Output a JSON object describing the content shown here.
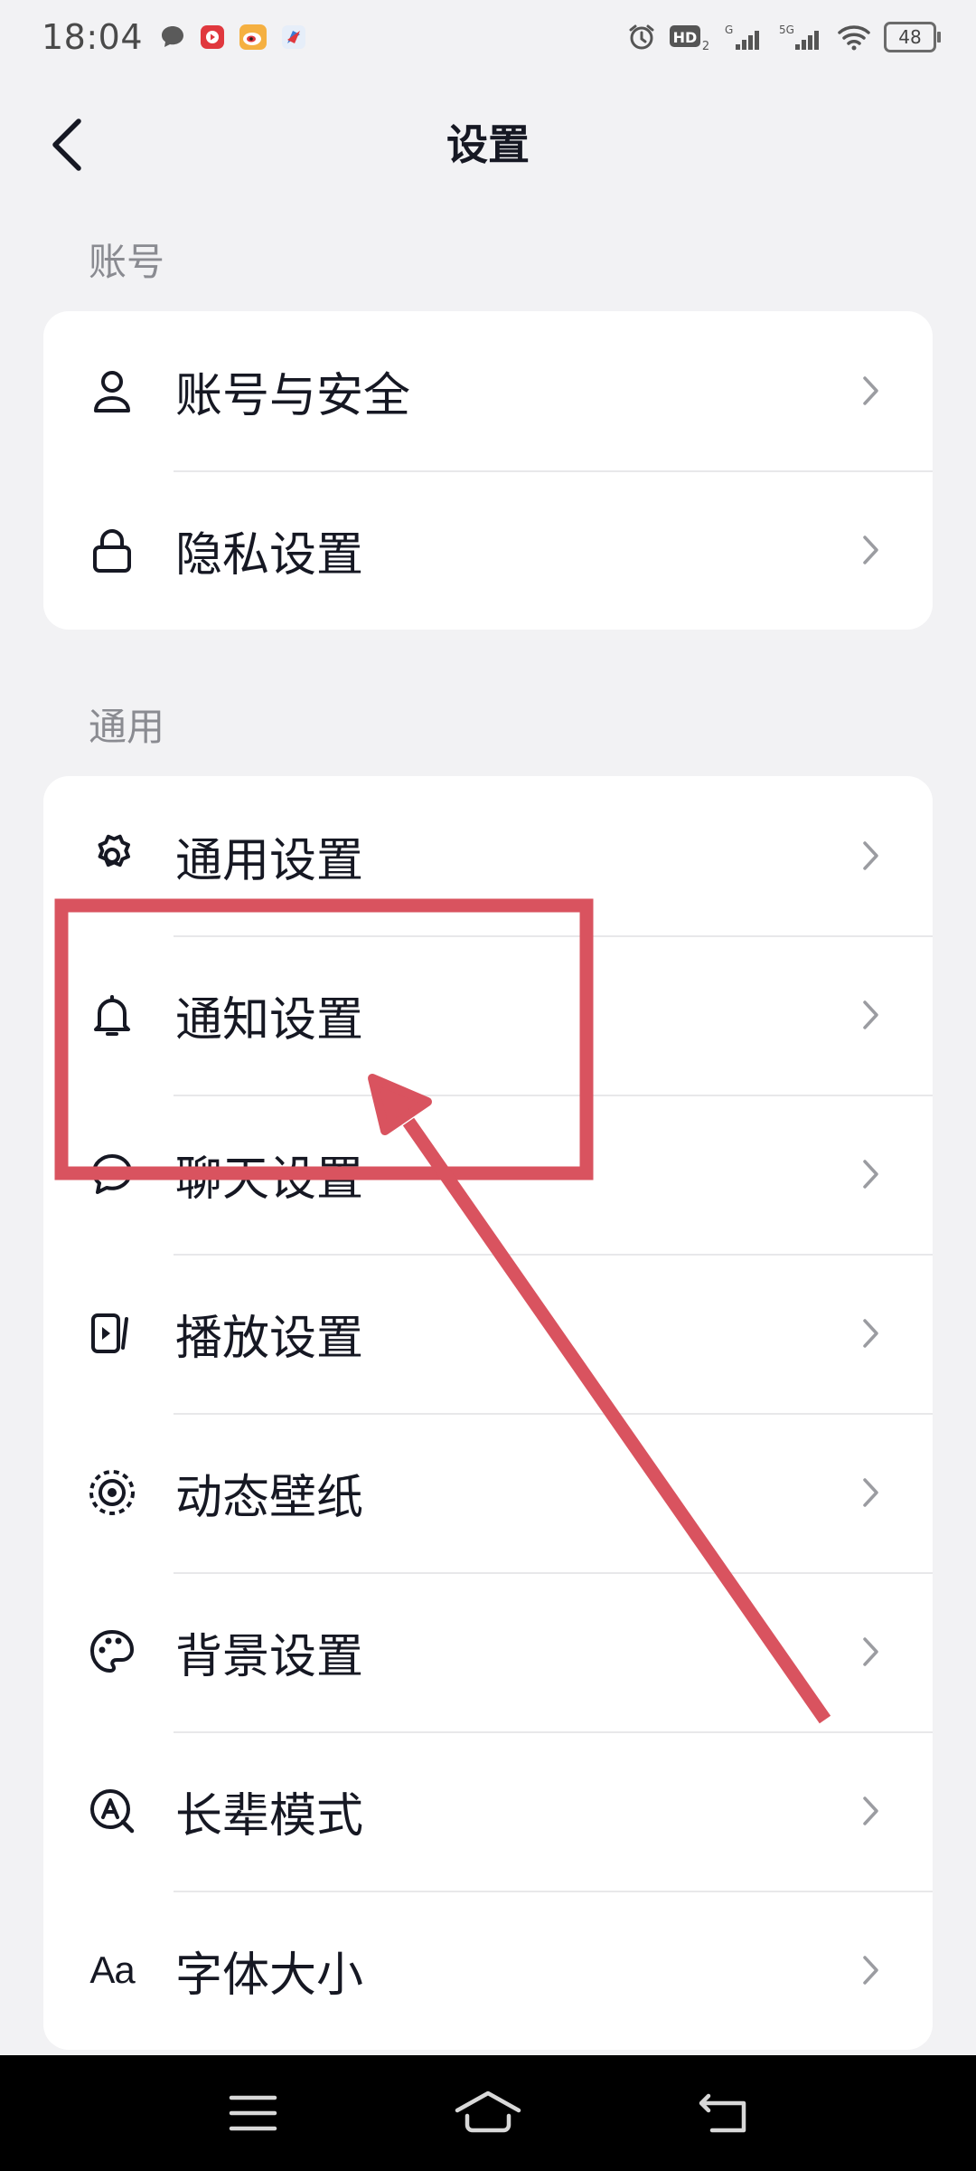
{
  "status_bar": {
    "time": "18:04",
    "battery": "48",
    "network": "5G"
  },
  "header": {
    "title": "设置"
  },
  "sections": [
    {
      "label": "账号",
      "items": [
        {
          "label": "账号与安全",
          "icon": "user-icon"
        },
        {
          "label": "隐私设置",
          "icon": "lock-icon"
        }
      ]
    },
    {
      "label": "通用",
      "items": [
        {
          "label": "通用设置",
          "icon": "gear-icon"
        },
        {
          "label": "通知设置",
          "icon": "bell-icon"
        },
        {
          "label": "聊天设置",
          "icon": "chat-bubble-icon"
        },
        {
          "label": "播放设置",
          "icon": "play-icon"
        },
        {
          "label": "动态壁纸",
          "icon": "live-wallpaper-icon"
        },
        {
          "label": "背景设置",
          "icon": "palette-icon"
        },
        {
          "label": "长辈模式",
          "icon": "elder-mode-icon"
        },
        {
          "label": "字体大小",
          "icon": "font-size-icon",
          "icon_text": "Aa"
        }
      ]
    }
  ],
  "colors": {
    "background": "#f2f2f4",
    "card": "#ffffff",
    "annotation": "#d9535f",
    "text_primary": "#161823",
    "text_secondary": "#8a8b91"
  }
}
